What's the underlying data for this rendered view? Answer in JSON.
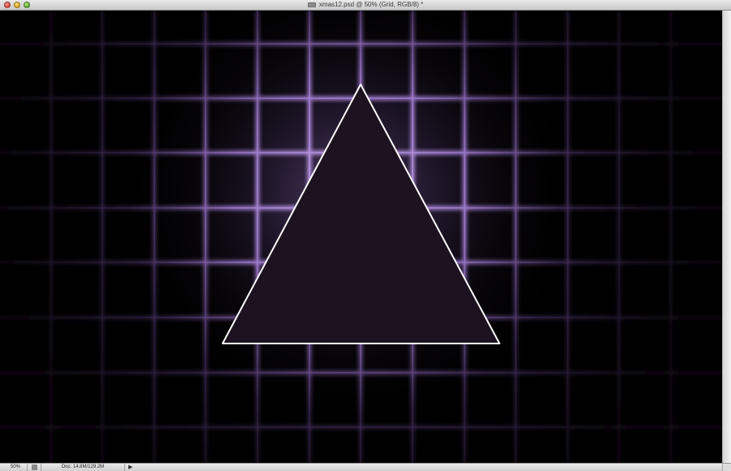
{
  "window": {
    "title": "xmas12.psd @ 50% (Grid, RGB/8) *"
  },
  "status": {
    "zoom": "50%",
    "doc_info": "Doc: 14.8M/129.2M"
  },
  "icons": {
    "close": "close-button-icon",
    "minimize": "minimize-button-icon",
    "zoom": "zoom-button-icon",
    "document": "document-proxy-icon",
    "status_menu": "triangle-right-icon"
  },
  "colors": {
    "grid_line": "#b48fe0",
    "glow": "#9a78c8",
    "triangle_fill": "#1d1220",
    "triangle_stroke": "#ffffff"
  }
}
